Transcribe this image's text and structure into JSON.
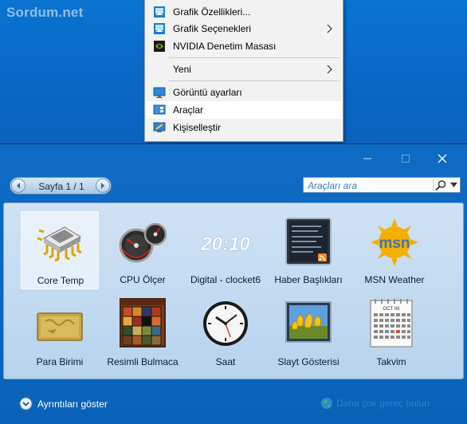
{
  "desktop": {
    "watermark": "Sordum.net"
  },
  "context_menu": {
    "items": [
      {
        "label": "Grafik Özellikleri...",
        "icon": "intel-graphics-icon"
      },
      {
        "label": "Grafik Seçenekleri",
        "icon": "intel-graphics-icon",
        "submenu": true
      },
      {
        "label": "NVIDIA Denetim Masası",
        "icon": "nvidia-icon"
      },
      {
        "label": "Yeni",
        "submenu": true
      },
      {
        "label": "Görüntü ayarları",
        "icon": "display-icon"
      },
      {
        "label": "Araçlar",
        "icon": "gadgets-icon",
        "highlighted": true
      },
      {
        "label": "Kişiselleştir",
        "icon": "personalize-icon"
      }
    ]
  },
  "gadget_window": {
    "pager": {
      "label": "Sayfa 1 / 1"
    },
    "search": {
      "placeholder": "Araçları ara"
    },
    "tiles": [
      {
        "label": "Core Temp",
        "icon": "chip-icon",
        "selected": true
      },
      {
        "label": "CPU Ölçer",
        "icon": "cpu-meter-icon"
      },
      {
        "label": "Digital - clocket6",
        "icon": "digital-clock-icon"
      },
      {
        "label": "Haber Başlıkları",
        "icon": "news-feed-icon"
      },
      {
        "label": "MSN Weather",
        "icon": "msn-weather-icon"
      },
      {
        "label": "Para Birimi",
        "icon": "currency-icon"
      },
      {
        "label": "Resimli Bulmaca",
        "icon": "picture-puzzle-icon"
      },
      {
        "label": "Saat",
        "icon": "clock-icon"
      },
      {
        "label": "Slayt Gösterisi",
        "icon": "slideshow-icon"
      },
      {
        "label": "Takvim",
        "icon": "calendar-icon"
      }
    ],
    "clock_text": "20:10",
    "calendar_month": "OCT 06",
    "details_label": "Ayrıntıları göster",
    "more_label": "Daha çok gereç bulun"
  }
}
